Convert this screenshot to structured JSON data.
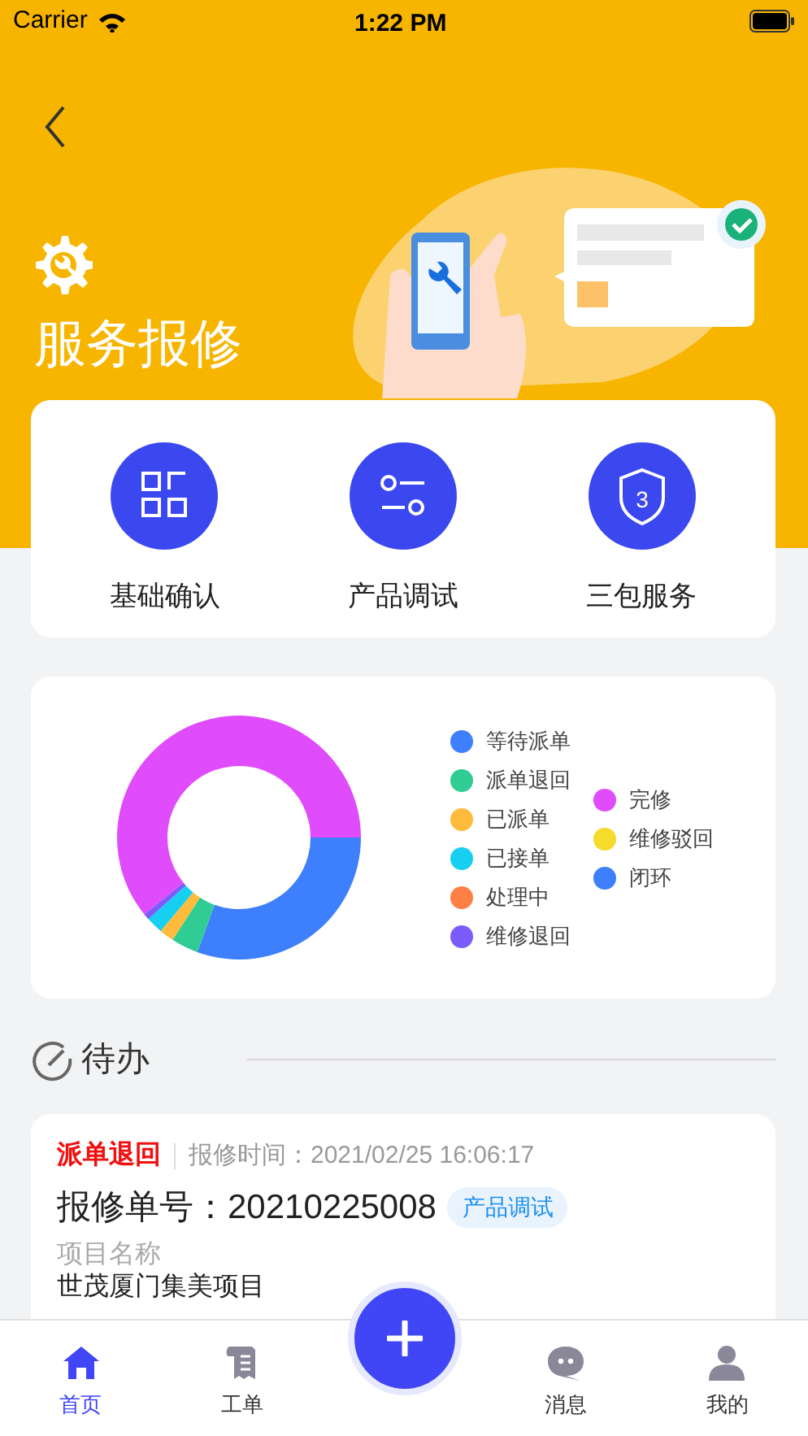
{
  "status_bar": {
    "carrier": "Carrier",
    "time": "1:22 PM"
  },
  "header": {
    "title": "服务报修"
  },
  "shortcuts": [
    {
      "kind": "grid",
      "label": "基础确认"
    },
    {
      "kind": "sliders",
      "label": "产品调试"
    },
    {
      "kind": "shield",
      "label": "三包服务",
      "icon_text": "3"
    }
  ],
  "legend": [
    {
      "label": "等待派单",
      "color": "#3d7ffc"
    },
    {
      "label": "派单退回",
      "color": "#2fcc94"
    },
    {
      "label": "已派单",
      "color": "#ffbb3b"
    },
    {
      "label": "已接单",
      "color": "#17cff0"
    },
    {
      "label": "处理中",
      "color": "#ff7f45"
    },
    {
      "label": "维修退回",
      "color": "#7a5cfb"
    },
    {
      "label": "完修",
      "color": "#e04cfb"
    },
    {
      "label": "维修驳回",
      "color": "#f5dc2a"
    },
    {
      "label": "闭环",
      "color": "#3d7ffc"
    }
  ],
  "todo": {
    "title": "待办",
    "items": [
      {
        "status": "派单退回",
        "time_label": "报修时间：",
        "time": "2021/02/25 16:06:17",
        "number_label": "报修单号：",
        "number": "20210225008",
        "tag": "产品调试",
        "project_label": "项目名称",
        "project": "世茂厦门集美项目"
      }
    ]
  },
  "tab_bar": [
    {
      "kind": "home",
      "label": "首页",
      "selected": true
    },
    {
      "kind": "orders",
      "label": "工单",
      "selected": false
    },
    {
      "kind": "add"
    },
    {
      "kind": "messages",
      "label": "消息",
      "selected": false
    },
    {
      "kind": "profile",
      "label": "我的",
      "selected": false
    }
  ]
}
